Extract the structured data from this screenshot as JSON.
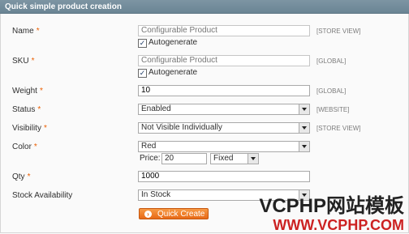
{
  "header": {
    "title": "Quick simple product creation"
  },
  "fields": {
    "name": {
      "label": "Name",
      "required": "*",
      "placeholder": "Configurable Product",
      "autogenerate": "Autogenerate",
      "scope": "[STORE VIEW]"
    },
    "sku": {
      "label": "SKU",
      "required": "*",
      "placeholder": "Configurable Product",
      "autogenerate": "Autogenerate",
      "scope": "[GLOBAL]"
    },
    "weight": {
      "label": "Weight",
      "required": "*",
      "value": "10",
      "scope": "[GLOBAL]"
    },
    "status": {
      "label": "Status",
      "required": "*",
      "value": "Enabled",
      "scope": "[WEBSITE]"
    },
    "visibility": {
      "label": "Visibility",
      "required": "*",
      "value": "Not Visible Individually",
      "scope": "[STORE VIEW]"
    },
    "color": {
      "label": "Color",
      "required": "*",
      "value": "Red",
      "price_label": "Price:",
      "price_value": "20",
      "price_type": "Fixed"
    },
    "qty": {
      "label": "Qty",
      "required": "*",
      "value": "1000"
    },
    "stock": {
      "label": "Stock Availability",
      "value": "In Stock"
    }
  },
  "button": {
    "label": "Quick Create",
    "icon": "arrow-right-icon"
  },
  "watermark": {
    "line1": "VCPHP网站模板",
    "line2": "WWW.VCPHP.COM"
  },
  "colors": {
    "header": "#6a8594",
    "accent": "#e86a17",
    "required": "#eb5e00"
  }
}
